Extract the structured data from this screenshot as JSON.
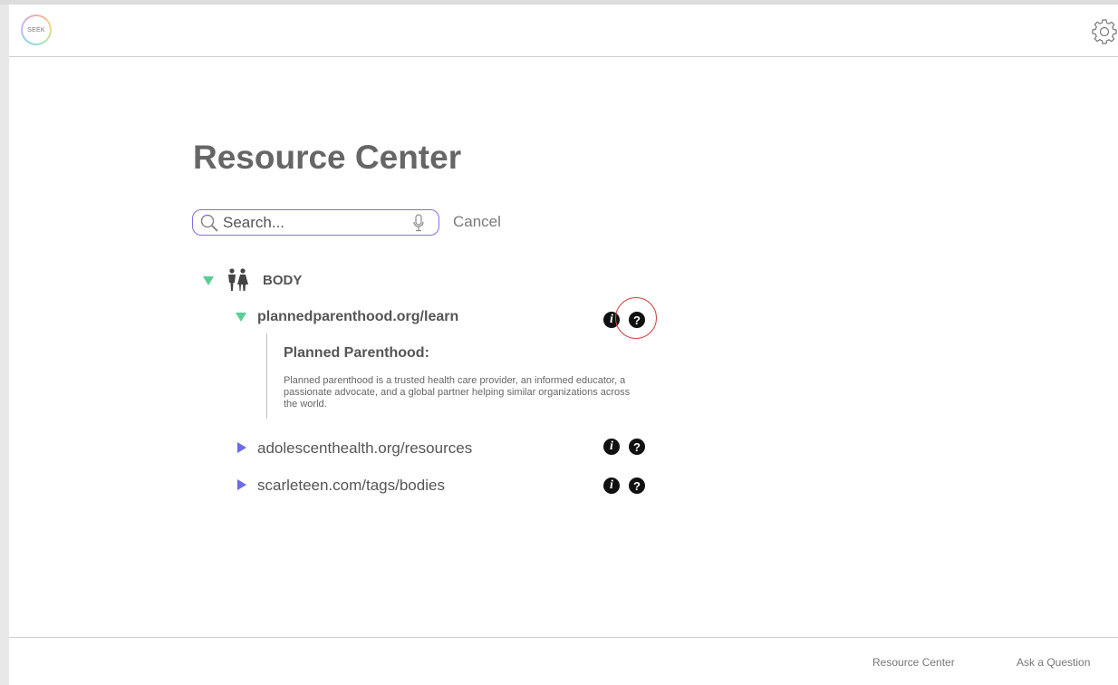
{
  "app": {
    "logo_text": "SEEK"
  },
  "header": {
    "settings_icon": "gear-icon"
  },
  "main": {
    "title": "Resource Center",
    "search": {
      "placeholder": "Search...",
      "value": "",
      "cancel_label": "Cancel"
    },
    "section": {
      "label": "BODY",
      "icon": "people-icon",
      "expanded": true,
      "items": [
        {
          "link": "plannedparenthood.org/learn",
          "expanded": true,
          "detail_title": "Planned Parenthood:",
          "detail_text": "Planned parenthood is a trusted health care provider, an informed educator, a passionate advocate, and a global partner helping similar organizations across the world."
        },
        {
          "link": "adolescenthealth.org/resources",
          "expanded": false
        },
        {
          "link": "scarleteen.com/tags/bodies",
          "expanded": false
        }
      ]
    }
  },
  "footer": {
    "links": [
      "Resource Center",
      "Ask a Question"
    ]
  },
  "colors": {
    "expand_green": "#5ccc95",
    "collapse_purple": "#6b6be6",
    "search_border": "#7b74e0",
    "highlight_red": "#d64545"
  }
}
